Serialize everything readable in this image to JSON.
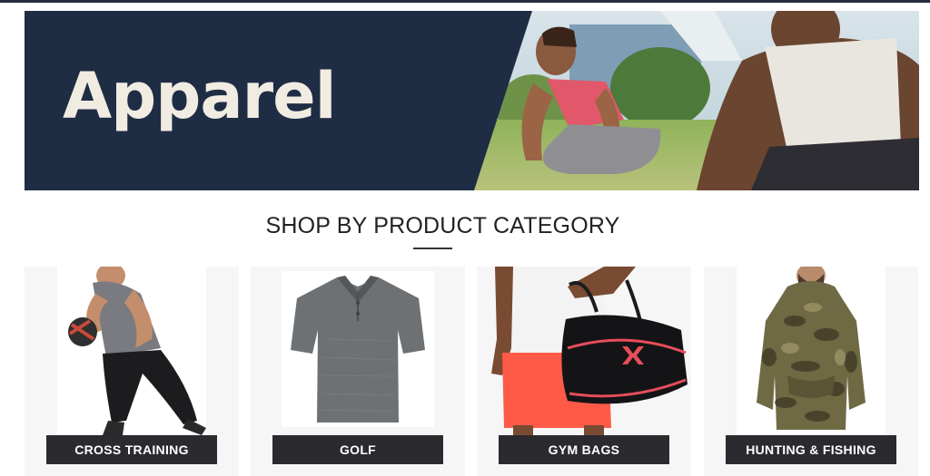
{
  "hero": {
    "title": "Apparel"
  },
  "section": {
    "title": "SHOP BY PRODUCT CATEGORY"
  },
  "categories": [
    {
      "label": "CROSS TRAINING"
    },
    {
      "label": "GOLF"
    },
    {
      "label": "GYM BAGS"
    },
    {
      "label": "HUNTING & FISHING"
    }
  ],
  "colors": {
    "hero_panel": "#1f2d44",
    "hero_title": "#f1ece2",
    "label_bg": "#2b2b2f",
    "card_bg": "#f6f6f6"
  }
}
